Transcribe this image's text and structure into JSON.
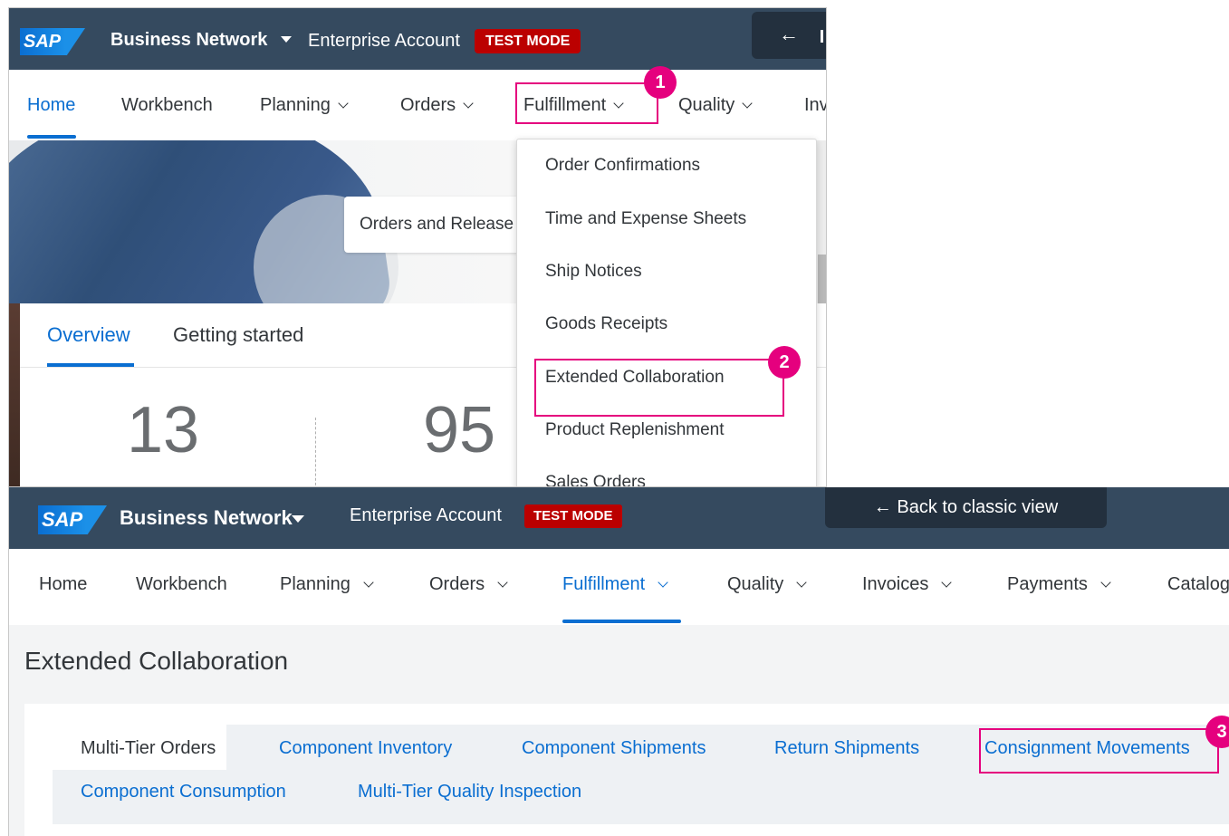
{
  "shot1": {
    "shell": {
      "logo": "SAP",
      "app_name": "Business Network",
      "account": "Enterprise Account",
      "mode_badge": "TEST MODE",
      "back_arrow": "←"
    },
    "nav": [
      {
        "label": "Home",
        "active": true
      },
      {
        "label": "Workbench"
      },
      {
        "label": "Planning"
      },
      {
        "label": "Orders"
      },
      {
        "label": "Fulfillment"
      },
      {
        "label": "Quality"
      },
      {
        "label": "Inv"
      }
    ],
    "hero_card": "Orders and Release",
    "hero_edge": "e",
    "tabs": [
      {
        "label": "Overview",
        "active": true
      },
      {
        "label": "Getting started"
      }
    ],
    "kpis": [
      "13",
      "95"
    ],
    "fulfillment_menu": [
      "Order Confirmations",
      "Time and Expense Sheets",
      "Ship Notices",
      "Goods Receipts",
      "Extended Collaboration",
      "Product Replenishment",
      "Sales Orders"
    ],
    "markers": [
      "1",
      "2"
    ]
  },
  "shot2": {
    "shell": {
      "logo": "SAP",
      "app_name": "Business Network",
      "account": "Enterprise Account",
      "mode_badge": "TEST MODE",
      "back_button": "← Back to classic view"
    },
    "nav": [
      {
        "label": "Home"
      },
      {
        "label": "Workbench"
      },
      {
        "label": "Planning"
      },
      {
        "label": "Orders"
      },
      {
        "label": "Fulfillment",
        "active": true
      },
      {
        "label": "Quality"
      },
      {
        "label": "Invoices"
      },
      {
        "label": "Payments"
      },
      {
        "label": "Catalog"
      }
    ],
    "page_title": "Extended Collaboration",
    "tabs": [
      {
        "label": "Multi-Tier Orders",
        "selected": true
      },
      {
        "label": "Component Inventory"
      },
      {
        "label": "Component Shipments"
      },
      {
        "label": "Return Shipments"
      },
      {
        "label": "Consignment Movements"
      },
      {
        "label": "Component Consumption"
      },
      {
        "label": "Multi-Tier Quality Inspection"
      }
    ],
    "markers": [
      "3"
    ]
  },
  "colors": {
    "shell": "#354a5f",
    "accent": "#0a6ed1",
    "test_badge": "#bb0000",
    "highlight": "#e5007e"
  }
}
